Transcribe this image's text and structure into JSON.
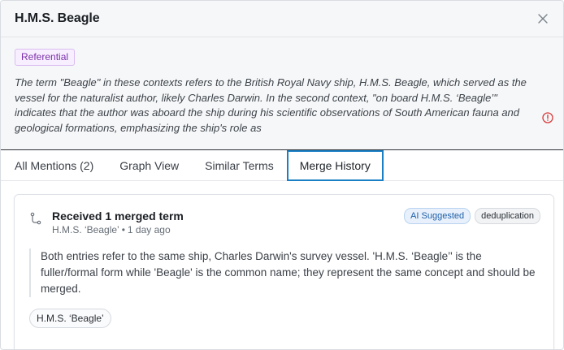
{
  "header": {
    "title": "H.M.S. Beagle"
  },
  "definition": {
    "badge": "Referential",
    "text": "The term \"Beagle\" in these contexts refers to the British Royal Navy ship, H.M.S. Beagle, which served as the vessel for the naturalist author, likely Charles Darwin. In the second context, \"on board H.M.S. ‘Beagle’\" indicates that the author was aboard the ship during his scientific observations of South American fauna and geological formations, emphasizing the ship's role as"
  },
  "tabs": [
    {
      "label": "All Mentions (2)"
    },
    {
      "label": "Graph View"
    },
    {
      "label": "Similar Terms"
    },
    {
      "label": "Merge History"
    }
  ],
  "merge_card": {
    "title": "Received 1 merged term",
    "source": "H.M.S. ‘Beagle’",
    "time": "1 day ago",
    "tags": [
      "AI Suggested",
      "deduplication"
    ],
    "reason": "Both entries refer to the same ship, Charles Darwin's survey vessel. 'H.M.S. ‘Beagle’' is the fuller/formal form while 'Beagle' is the common name; they represent the same concept and should be merged.",
    "chip": "H.M.S. ‘Beagle’"
  },
  "colors": {
    "accent": "#1a7fc4",
    "badge_purple": "#7b2fa8",
    "warning_red": "#d93a3a"
  }
}
